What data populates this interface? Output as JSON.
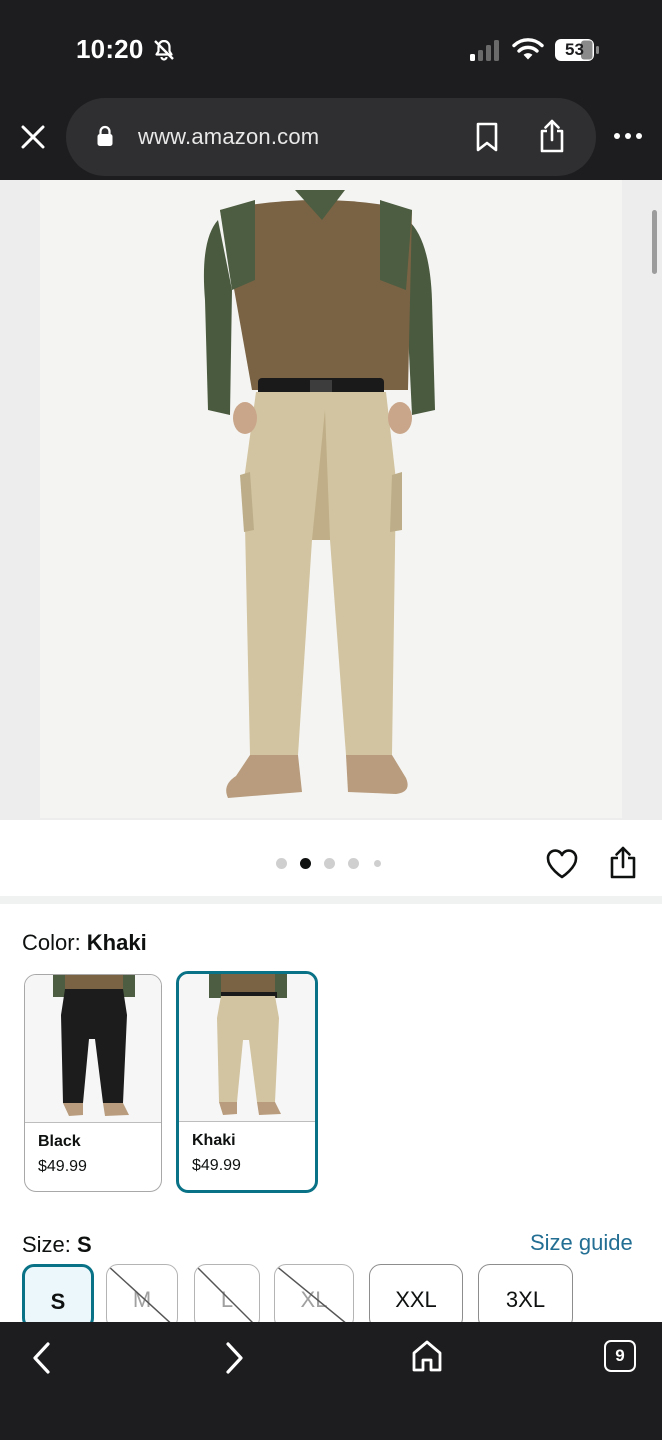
{
  "status_bar": {
    "time": "10:20",
    "battery": "53"
  },
  "browser": {
    "url": "www.amazon.com",
    "tabs_count": "9"
  },
  "gallery": {
    "image_count": 5,
    "active_index": 1
  },
  "color": {
    "label": "Color: ",
    "selected": "Khaki",
    "options": [
      {
        "name": "Black",
        "price": "$49.99",
        "selected": false
      },
      {
        "name": "Khaki",
        "price": "$49.99",
        "selected": true
      }
    ]
  },
  "size": {
    "label": "Size: ",
    "selected": "S",
    "guide_link": "Size guide",
    "options": [
      {
        "label": "S",
        "available": true,
        "selected": true
      },
      {
        "label": "M",
        "available": false,
        "selected": false
      },
      {
        "label": "L",
        "available": false,
        "selected": false
      },
      {
        "label": "XL",
        "available": false,
        "selected": false
      },
      {
        "label": "XXL",
        "available": true,
        "selected": false
      },
      {
        "label": "3XL",
        "available": true,
        "selected": false
      }
    ]
  },
  "colors": {
    "accent_teal": "#0a7286",
    "link_blue": "#236e93",
    "chrome_dark": "#1d1d1f"
  }
}
